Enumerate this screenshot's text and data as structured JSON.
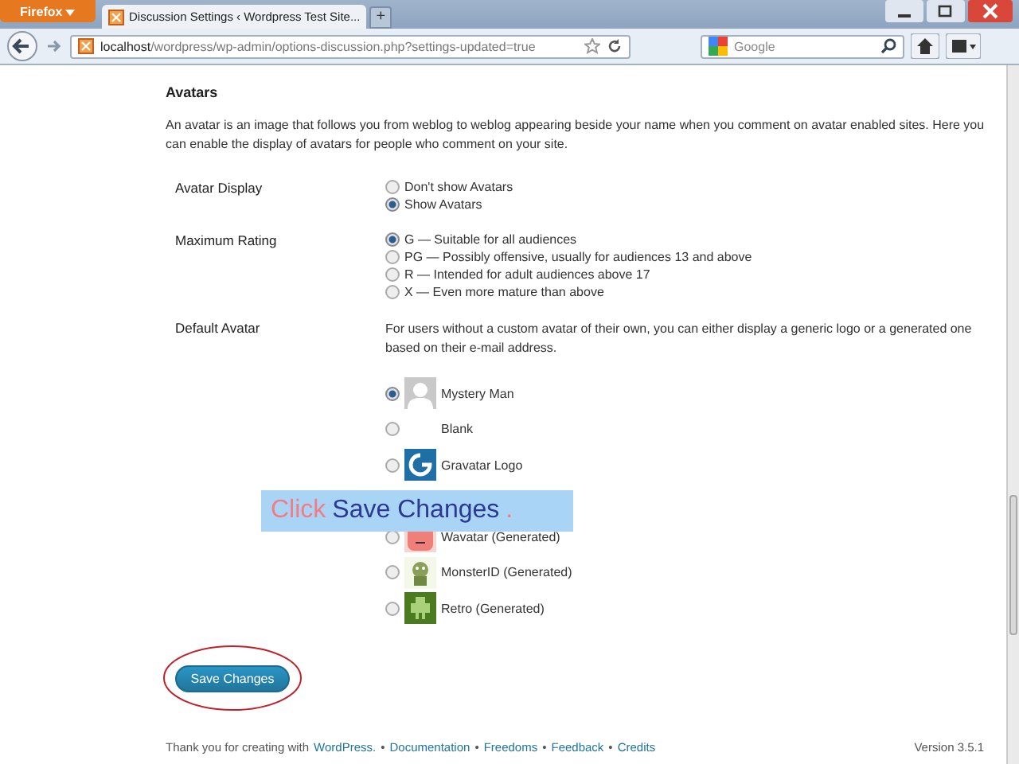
{
  "browser": {
    "app_button": "Firefox",
    "tabs": [
      {
        "title": "Discussion Settings ‹ Wordpress Test Site...",
        "selected": true
      }
    ],
    "new_tab": "+",
    "url_host": "localhost",
    "url_path": "/wordpress/wp-admin/options-discussion.php?settings-updated=true",
    "search_placeholder": "Google"
  },
  "section": {
    "title": "Avatars",
    "description": "An avatar is an image that follows you from weblog to weblog appearing beside your name when you comment on avatar enabled sites. Here you can enable the display of avatars for people who comment on your site."
  },
  "fields": [
    {
      "label": "Avatar Display",
      "options": [
        {
          "label": "Don't show Avatars",
          "selected": false
        },
        {
          "label": "Show Avatars",
          "selected": true
        }
      ]
    },
    {
      "label": "Maximum Rating",
      "options": [
        {
          "label": "G — Suitable for all audiences",
          "selected": true
        },
        {
          "label": "PG — Possibly offensive, usually for audiences 13 and above",
          "selected": false
        },
        {
          "label": "R — Intended for adult audiences above 17",
          "selected": false
        },
        {
          "label": "X — Even more mature than above",
          "selected": false
        }
      ]
    }
  ],
  "default_avatar": {
    "label": "Default Avatar",
    "description": "For users without a custom avatar of their own, you can either display a generic logo or a generated one based on their e-mail address.",
    "options": [
      {
        "kind": "mystery",
        "label": "Mystery Man",
        "selected": true
      },
      {
        "kind": "blank",
        "label": "Blank",
        "selected": false
      },
      {
        "kind": "gravatar",
        "label": "Gravatar Logo",
        "selected": false
      },
      {
        "kind": "covered"
      },
      {
        "kind": "wavatar",
        "label": "Wavatar (Generated)",
        "selected": false
      },
      {
        "kind": "monsterid",
        "label": "MonsterID (Generated)",
        "selected": false
      },
      {
        "kind": "retro",
        "label": "Retro (Generated)",
        "selected": false
      }
    ]
  },
  "save_button": "Save Changes",
  "caption": [
    {
      "text": "Click",
      "color": "#f07c84"
    },
    {
      "text": "Save Changes",
      "color": "#2b3990"
    },
    {
      "text": ".",
      "color": "#f07c84"
    }
  ],
  "footer": {
    "text": "Thank you for creating with",
    "links": [
      "WordPress.",
      "Documentation",
      "Freedoms",
      "Feedback",
      "Credits"
    ],
    "separator": "•",
    "version": "Version 3.5.1"
  }
}
